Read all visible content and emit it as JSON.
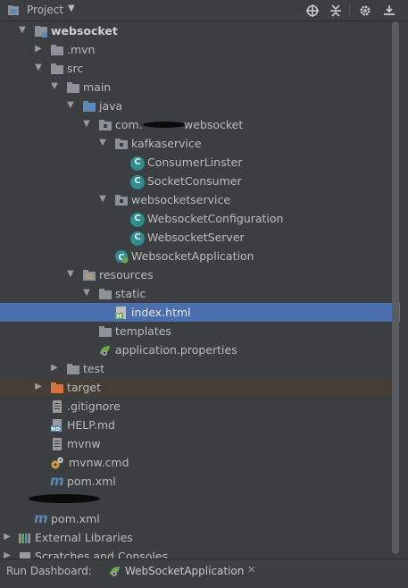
{
  "header": {
    "title": "Project",
    "icons": [
      "target-icon",
      "collapse-icon",
      "gear-icon",
      "hide-icon"
    ]
  },
  "tree": [
    {
      "label": "websocket",
      "icon": "module-folder"
    },
    {
      "label": ".mvn",
      "icon": "folder"
    },
    {
      "label": "src",
      "icon": "folder"
    },
    {
      "label": "main",
      "icon": "folder"
    },
    {
      "label": "java",
      "icon": "source-folder"
    },
    {
      "label": "com.",
      "label_suffix": "websocket",
      "icon": "package"
    },
    {
      "label": "kafkaservice",
      "icon": "package"
    },
    {
      "label": "ConsumerLinster",
      "icon": "class"
    },
    {
      "label": "SocketConsumer",
      "icon": "class"
    },
    {
      "label": "websocketservice",
      "icon": "package"
    },
    {
      "label": "WebsocketConfiguration",
      "icon": "class"
    },
    {
      "label": "WebsocketServer",
      "icon": "class"
    },
    {
      "label": "WebsocketApplication",
      "icon": "spring-class"
    },
    {
      "label": "resources",
      "icon": "resources-folder"
    },
    {
      "label": "static",
      "icon": "folder"
    },
    {
      "label": "index.html",
      "icon": "html-file"
    },
    {
      "label": "templates",
      "icon": "folder"
    },
    {
      "label": "application.properties",
      "icon": "properties-file"
    },
    {
      "label": "test",
      "icon": "folder"
    },
    {
      "label": "target",
      "icon": "excluded-folder"
    },
    {
      "label": ".gitignore",
      "icon": "text-file"
    },
    {
      "label": "HELP.md",
      "icon": "markdown-file"
    },
    {
      "label": "mvnw",
      "icon": "text-file"
    },
    {
      "label": "mvnw.cmd",
      "icon": "cmd-file"
    },
    {
      "label": "pom.xml",
      "icon": "maven-file"
    },
    {
      "label": "pom.xml",
      "icon": "maven-file"
    },
    {
      "label": "External Libraries",
      "icon": "libraries"
    },
    {
      "label": "Scratches and Consoles",
      "icon": "scratches"
    }
  ],
  "bottom": {
    "label": "Run Dashboard:",
    "tab_label": "WebSocketApplication",
    "tab_close": "✕"
  },
  "colors": {
    "background": "#3c3f41",
    "selection": "#4b6eaf",
    "excluded_row": "#453e37",
    "class_icon": "#2d8d8f",
    "folder": "#8d9199",
    "source_folder": "#5c89b8",
    "excluded_folder": "#d4733a"
  }
}
